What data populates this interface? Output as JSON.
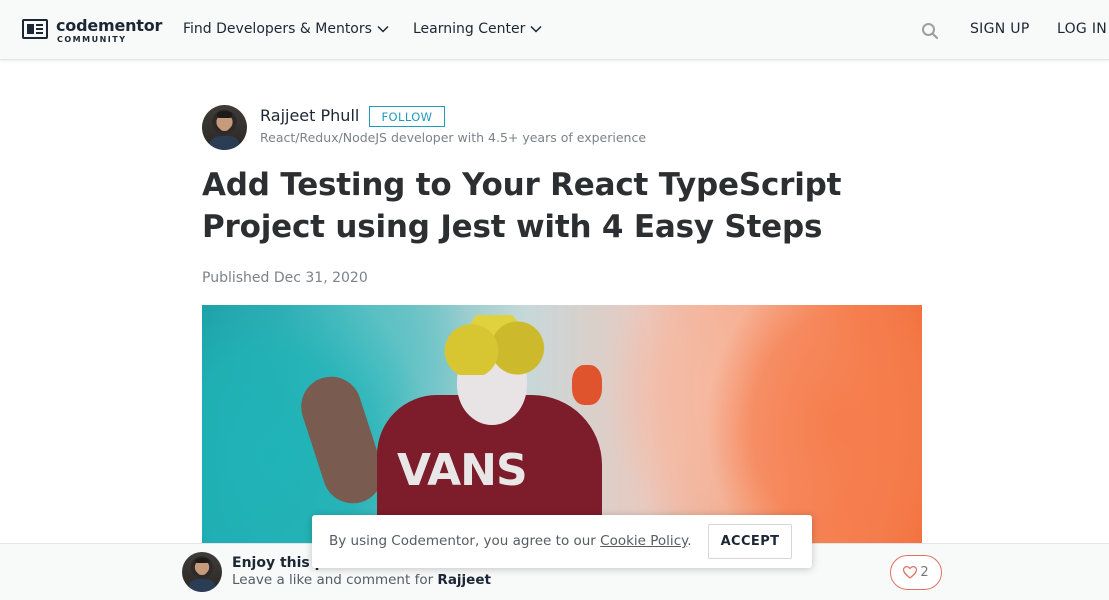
{
  "header": {
    "logo_word": "codementor",
    "logo_sub": "COMMUNITY",
    "nav": [
      {
        "label": "Find Developers & Mentors"
      },
      {
        "label": "Learning Center"
      }
    ],
    "sign_up": "SIGN UP",
    "log_in": "LOG IN"
  },
  "author": {
    "name": "Rajjeet Phull",
    "follow_label": "FOLLOW",
    "bio": "React/Redux/NodeJS developer with 4.5+ years of experience"
  },
  "article": {
    "title": "Add Testing to Your React TypeScript Project using Jest with 4 Easy Steps",
    "published": "Published Dec 31, 2020",
    "hero_text": "VANS"
  },
  "bottom_bar": {
    "enjoy_text": "Enjoy this p",
    "leave_prefix": "Leave a like and comment for ",
    "leave_name": "Rajjeet",
    "like_count": "2"
  },
  "cookie": {
    "text_before": "By using Codementor, you agree to our ",
    "link_text": "Cookie Policy",
    "text_after": ".",
    "accept_label": "ACCEPT"
  },
  "colors": {
    "accent": "#1e9bbf",
    "heart": "#e0725f",
    "header_bg": "#f8f9f9"
  },
  "icons": {
    "logo": "codementor-logo-icon",
    "chevron": "chevron-down-icon",
    "search": "search-icon",
    "heart": "heart-icon"
  }
}
